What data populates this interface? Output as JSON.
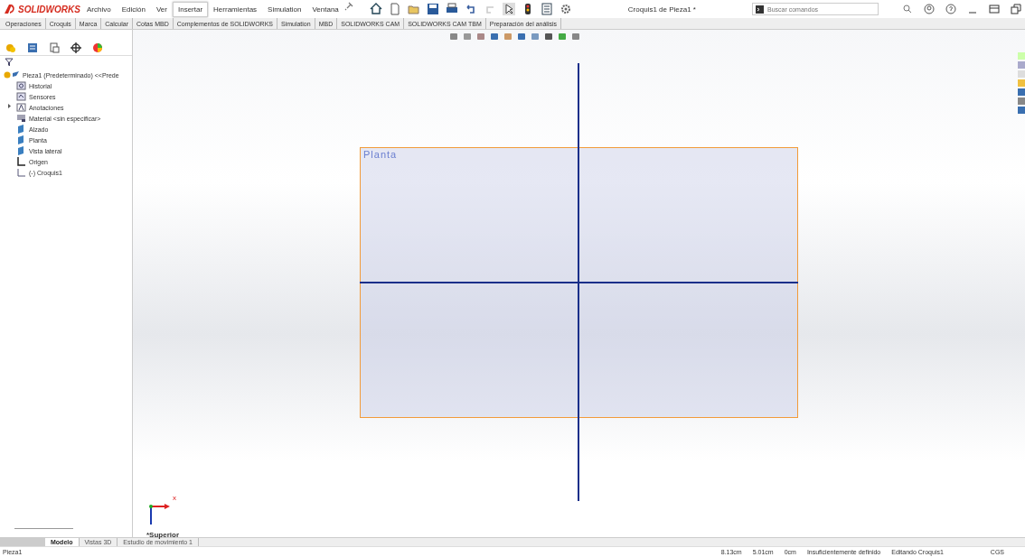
{
  "app": {
    "logo": "SOLIDWORKS"
  },
  "menu": [
    {
      "label": "Archivo",
      "selected": false
    },
    {
      "label": "Edición",
      "selected": false
    },
    {
      "label": "Ver",
      "selected": false
    },
    {
      "label": "Insertar",
      "selected": true
    },
    {
      "label": "Herramientas",
      "selected": false
    },
    {
      "label": "Simulation",
      "selected": false
    },
    {
      "label": "Ventana",
      "selected": false
    }
  ],
  "window": {
    "title": "Croquis1 de Pieza1 *"
  },
  "search": {
    "placeholder": "Buscar comandos"
  },
  "command_tabs": [
    "Operaciones",
    "Croquis",
    "Marca",
    "Calcular",
    "Cotas MBD",
    "Complementos de SOLIDWORKS",
    "Simulation",
    "MBD",
    "SOLIDWORKS CAM",
    "SOLIDWORKS CAM TBM",
    "Preparación del análisis"
  ],
  "feature_tree": {
    "root": {
      "label": "Pieza1 (Predeterminado) <<Prede",
      "children": [
        {
          "label": "Historial",
          "kind": "history"
        },
        {
          "label": "Sensores",
          "kind": "sensors"
        },
        {
          "label": "Anotaciones",
          "kind": "annotations",
          "expanded": false
        },
        {
          "label": "Material <sin especificar>",
          "kind": "material"
        },
        {
          "label": "Alzado",
          "kind": "plane"
        },
        {
          "label": "Planta",
          "kind": "plane"
        },
        {
          "label": "Vista lateral",
          "kind": "plane"
        },
        {
          "label": "Origen",
          "kind": "origin"
        },
        {
          "label": "(-) Croquis1",
          "kind": "sketch"
        }
      ]
    }
  },
  "canvas": {
    "plane_label": "Planta",
    "view_label": "*Superior",
    "triad_x": "x"
  },
  "bottom_tabs": [
    {
      "label": "Modelo",
      "selected": true
    },
    {
      "label": "Vistas 3D",
      "selected": false
    },
    {
      "label": "Estudio de movimiento 1",
      "selected": false
    }
  ],
  "status_bar": {
    "document": "Pieza1",
    "x": "8.13cm",
    "y": "5.01cm",
    "z": "0cm",
    "definition": "Insuficientemente definido",
    "mode": "Editando Croquis1",
    "units": "CGS"
  }
}
